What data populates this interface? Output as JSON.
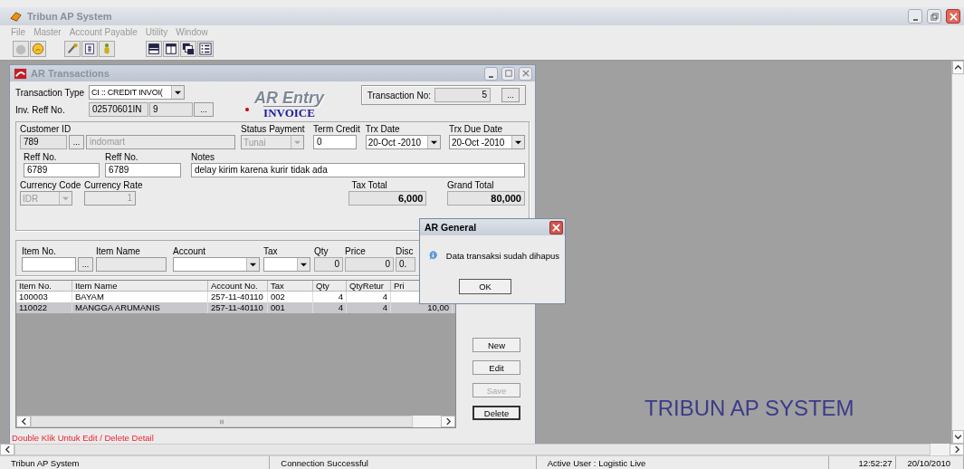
{
  "app": {
    "title": "Tribun AP System",
    "menu": [
      "File",
      "Master",
      "Account Payable",
      "Utility",
      "Window"
    ]
  },
  "child": {
    "title": "AR Transactions",
    "transaction_type": {
      "label": "Transaction Type",
      "value": "CI :: CREDIT INVOI("
    },
    "inv_reff": {
      "label": "Inv. Reff No.",
      "value": "02570601IN",
      "value_2": "9",
      "button": "..."
    },
    "logo": {
      "line_1": "AR Entry",
      "line_2": "INVOICE"
    },
    "transaction_no": {
      "label": "Transaction No:",
      "value": "5",
      "button": "..."
    },
    "header": {
      "customer_id": {
        "label": "Customer ID",
        "value": "789",
        "button": "...",
        "name": "indomart"
      },
      "status_payment": {
        "label": "Status Payment",
        "value": "Tunai",
        "disabled": true
      },
      "term_credit": {
        "label": "Term Credit",
        "value": "0"
      },
      "trx_date": {
        "label": "Trx Date",
        "value": "20-Oct -2010"
      },
      "trx_due_date": {
        "label": "Trx Due Date",
        "value": "20-Oct -2010"
      },
      "reff_no_1": {
        "label": "Reff No.",
        "value": "6789"
      },
      "reff_no_2": {
        "label": "Reff No.",
        "value": "6789"
      },
      "notes": {
        "label": "Notes",
        "value": "delay kirim karena kurir tidak ada"
      },
      "currency_code": {
        "label": "Currency Code",
        "value": "IDR",
        "disabled": true
      },
      "currency_rate": {
        "label": "Currency Rate",
        "value": "1",
        "disabled": true
      },
      "tax_total": {
        "label": "Tax Total",
        "value": "6,000"
      },
      "grand_total": {
        "label": "Grand Total",
        "value": "80,000"
      }
    },
    "entry": {
      "item_no": {
        "label": "Item No.",
        "button": "..."
      },
      "item_name": {
        "label": "Item Name"
      },
      "account": {
        "label": "Account"
      },
      "tax": {
        "label": "Tax"
      },
      "qty": {
        "label": "Qty",
        "value": "0"
      },
      "price": {
        "label": "Price",
        "value": "0"
      },
      "disc": {
        "label": "Disc",
        "value": "0."
      }
    },
    "table": {
      "columns": [
        "Item No.",
        "Item Name",
        "Account No.",
        "Tax",
        "Qty",
        "QtyRetur",
        "Pri"
      ],
      "rows": [
        {
          "cells": [
            "100003",
            "BAYAM",
            "257-11-40110",
            "002",
            "4",
            "4"
          ],
          "selected": false
        },
        {
          "cells": [
            "110022",
            "MANGGA ARUMANIS",
            "257-11-40110",
            "001",
            "4",
            "4",
            "10,00"
          ],
          "selected": true
        }
      ]
    },
    "buttons": [
      {
        "label": "New",
        "disabled": false,
        "default": false
      },
      {
        "label": "Edit",
        "disabled": false,
        "default": false
      },
      {
        "label": "Save",
        "disabled": true,
        "default": false
      },
      {
        "label": "Delete",
        "disabled": false,
        "default": true
      }
    ],
    "hint": "Double Klik Untuk Edit / Delete Detail"
  },
  "background_text": "TRIBUN AP SYSTEM",
  "dialog": {
    "title": "AR General",
    "message": "Data transaksi sudah dihapus",
    "button": "OK"
  },
  "status_bar": [
    "Tribun AP System",
    "Connection Successful",
    "Active User : Logistic Live",
    "12:52:27",
    "20/10/2010"
  ]
}
